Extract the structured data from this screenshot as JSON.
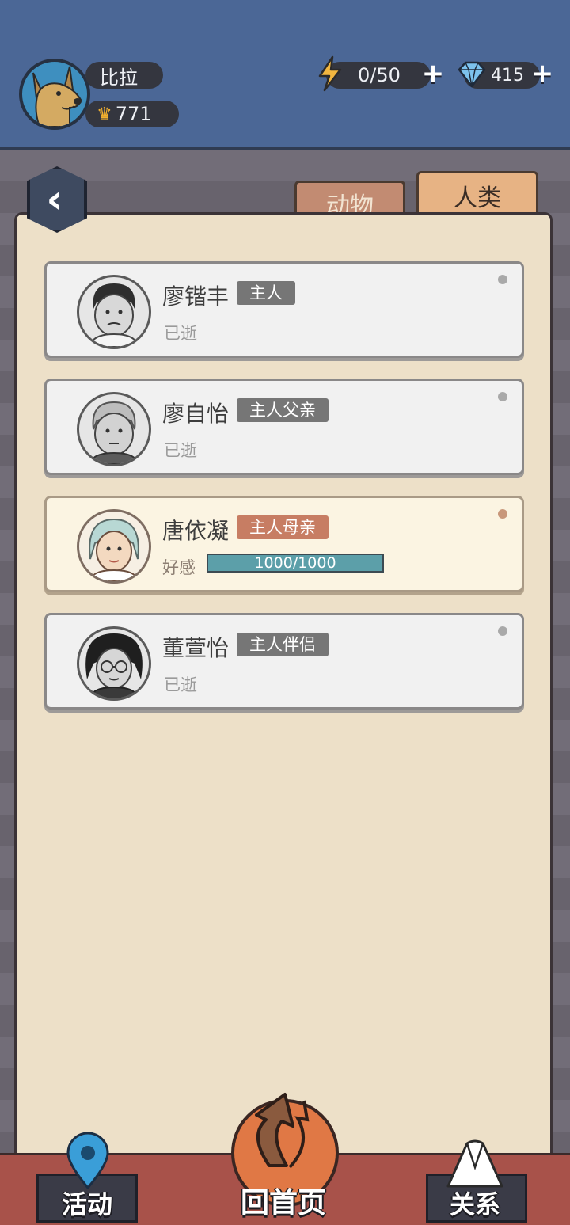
{
  "header": {
    "player_name": "比拉",
    "crown_count": "771",
    "energy": "0/50",
    "gems": "415"
  },
  "tabs": [
    {
      "label": "动物",
      "active": false
    },
    {
      "label": "人类",
      "active": true
    }
  ],
  "people": [
    {
      "name": "廖锴丰",
      "role": "主人",
      "status": "已逝",
      "active": false
    },
    {
      "name": "廖自怡",
      "role": "主人父亲",
      "status": "已逝",
      "active": false
    },
    {
      "name": "唐依凝",
      "role": "主人母亲",
      "favor_label": "好感",
      "favor_text": "1000/1000",
      "favor_fraction": 1.0,
      "active": true
    },
    {
      "name": "董萱怡",
      "role": "主人伴侣",
      "status": "已逝",
      "active": false
    }
  ],
  "nav": {
    "activity": "活动",
    "home": "回首页",
    "relations": "关系"
  },
  "colors": {
    "header_bg": "#4b6796",
    "panel_bg": "#ede0c8",
    "badge_gray": "#767676",
    "badge_active": "#c77d63",
    "favor_fill": "#5c9fa9"
  }
}
